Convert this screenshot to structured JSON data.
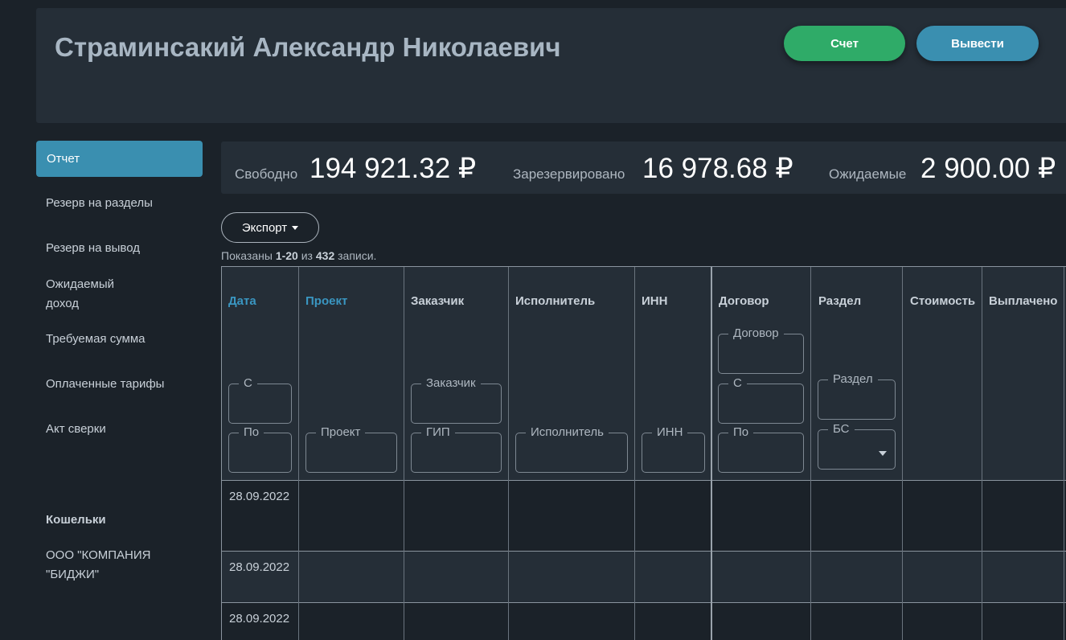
{
  "header": {
    "title": "Страминсакий Александр Николаевич",
    "account_button": "Счет",
    "withdraw_button": "Вывести"
  },
  "sidebar": {
    "active": "Отчет",
    "items": [
      "Резерв на разделы",
      "Резерв на вывод",
      "Ожидаемый",
      "доход",
      "Требуемая сумма",
      "Оплаченные тарифы",
      "Акт сверки"
    ],
    "wallets_title": "Кошельки",
    "wallet_line1": "ООО \"КОМПАНИЯ",
    "wallet_line2": "\"БИДЖИ\""
  },
  "balance": {
    "free_label": "Свободно",
    "free_value": "194 921.32 ₽",
    "reserved_label": "Зарезервировано",
    "reserved_value": "16 978.68 ₽",
    "expected_label": "Ожидаемые",
    "expected_value": "2 900.00 ₽"
  },
  "toolbar": {
    "export_label": "Экспорт"
  },
  "summary": {
    "prefix": "Показаны ",
    "range": "1-20",
    "middle": " из ",
    "total": "432",
    "suffix": " записи."
  },
  "table": {
    "columns": {
      "date": "Дата",
      "project": "Проект",
      "customer": "Заказчик",
      "executor": "Исполнитель",
      "inn": "ИНН",
      "contract": "Договор",
      "section": "Раздел",
      "cost": "Стоимость",
      "paid": "Выплачено"
    },
    "filters": {
      "date_from": "С",
      "date_to": "По",
      "project": "Проект",
      "customer": "Заказчик",
      "gip": "ГИП",
      "executor": "Исполнитель",
      "inn": "ИНН",
      "contract": "Договор",
      "contract_from": "С",
      "contract_to": "По",
      "section": "Раздел",
      "bs": "БС"
    },
    "rows": [
      {
        "date": "28.09.2022"
      },
      {
        "date": "28.09.2022"
      },
      {
        "date": "28.09.2022"
      }
    ]
  }
}
